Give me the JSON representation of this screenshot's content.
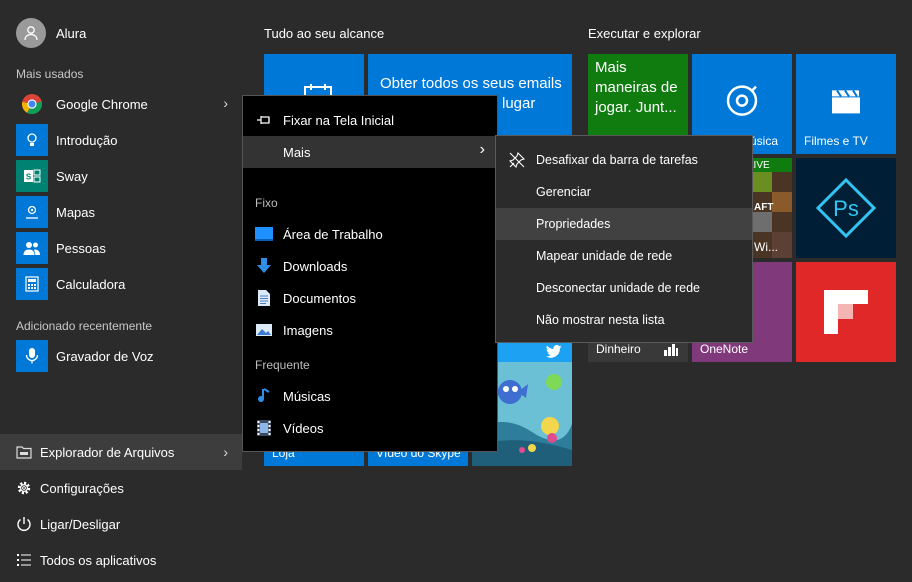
{
  "user": {
    "name": "Alura"
  },
  "most_used": {
    "label": "Mais usados",
    "items": [
      {
        "label": "Google Chrome",
        "icon": "chrome-icon",
        "has_arrow": true
      },
      {
        "label": "Introdução",
        "icon": "lightbulb-icon"
      },
      {
        "label": "Sway",
        "icon": "sway-icon"
      },
      {
        "label": "Mapas",
        "icon": "maps-icon"
      },
      {
        "label": "Pessoas",
        "icon": "people-icon"
      },
      {
        "label": "Calculadora",
        "icon": "calculator-icon"
      }
    ]
  },
  "recent": {
    "label": "Adicionado recentemente",
    "items": [
      {
        "label": "Gravador de Voz",
        "icon": "microphone-icon"
      }
    ]
  },
  "bottom": {
    "file_explorer": "Explorador de Arquivos",
    "settings": "Configurações",
    "power": "Ligar/Desligar",
    "all_apps": "Todos os aplicativos"
  },
  "groups": {
    "left": "Tudo ao seu alcance",
    "right": "Executar e explorar"
  },
  "tiles": {
    "mail_text": "Obter todos os seus emails",
    "mail_text2": "lugar",
    "xbox_text": "Mais maneiras de jogar. Junt...",
    "music_label": "úsica",
    "movies_label": "Filmes e TV",
    "live_label": "LIVE",
    "minecraft_label": "Wi...",
    "money_label": "Dinheiro",
    "onenote_label": "OneNote",
    "twitter_label": "ter",
    "store_label": "Loja",
    "skype_label": "Vídeo do Skype"
  },
  "menu1": {
    "pin": "Fixar na Tela Inicial",
    "more": "Mais",
    "pinned_label": "Fixo",
    "pinned": [
      {
        "label": "Área de Trabalho",
        "icon": "desktop-icon"
      },
      {
        "label": "Downloads",
        "icon": "download-icon"
      },
      {
        "label": "Documentos",
        "icon": "document-icon"
      },
      {
        "label": "Imagens",
        "icon": "pictures-icon"
      }
    ],
    "frequent_label": "Frequente",
    "frequent": [
      {
        "label": "Músicas",
        "icon": "music-icon"
      },
      {
        "label": "Vídeos",
        "icon": "video-icon"
      }
    ]
  },
  "menu2": {
    "items": [
      "Desafixar da barra de tarefas",
      "Gerenciar",
      "Propriedades",
      "Mapear unidade de rede",
      "Desconectar unidade de rede",
      "Não mostrar nesta lista"
    ]
  },
  "colors": {
    "accent": "#0078d7",
    "xbox_green": "#107c10",
    "onenote_purple": "#80397b",
    "flipboard_red": "#e12828",
    "photoshop_dark": "#001e36"
  }
}
